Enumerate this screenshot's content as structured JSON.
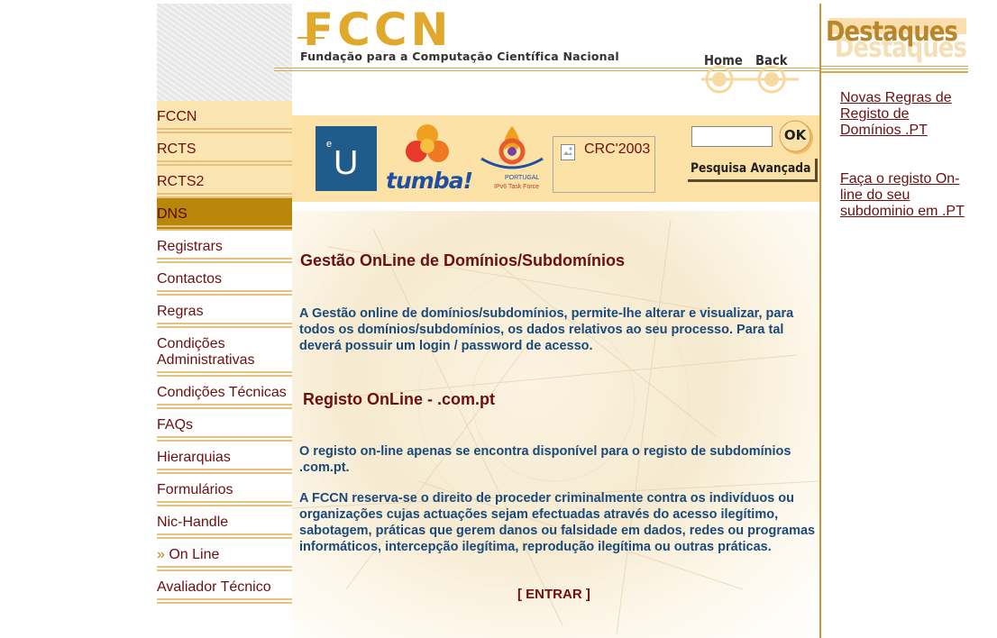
{
  "header": {
    "logo_text": "FCCN",
    "logo_subtitle": "Fundação para a Computação Científica Nacional",
    "home_label": "Home",
    "back_label": "Back"
  },
  "nav": {
    "items": [
      {
        "label": "FCCN"
      },
      {
        "label": "RCTS"
      },
      {
        "label": "RCTS2"
      },
      {
        "label": "DNS"
      },
      {
        "label": "Registrars"
      },
      {
        "label": "Contactos"
      },
      {
        "label": "Regras"
      },
      {
        "label": "Condições Administrativas"
      },
      {
        "label": "Condições Técnicas"
      },
      {
        "label": "FAQs"
      },
      {
        "label": "Hierarquias"
      },
      {
        "label": "Formulários"
      },
      {
        "label": "Nic-Handle"
      },
      {
        "label": "On Line",
        "marker": "»"
      },
      {
        "label": "Avaliador Técnico"
      }
    ]
  },
  "toolbar": {
    "eu_logo": {
      "super": "e",
      "letter": "U"
    },
    "tumba_label": "tumba!",
    "ipv6_caption1": "PORTUGAL",
    "ipv6_caption2": "IPv6 Task Force",
    "crc_label": "CRC'2003",
    "search_value": "",
    "ok_label": "OK",
    "advanced_search_label": "Pesquisa Avançada"
  },
  "main": {
    "section1_title": "Gestão OnLine de Domínios/Subdomínios",
    "section1_text": "A Gestão online de domínios/subdomínios, permite-lhe alterar e visualizar, para todos os domínios/subdomínios, os dados relativos ao seu processo. Para tal deverá possuir um login / password de acesso.",
    "section2_title": "Registo OnLine - .com.pt",
    "section2_text": "O registo on-line apenas se encontra disponível para o registo de subdomínios .com.pt.",
    "section2_text2": "A FCCN reserva-se o direito de proceder criminalmente contra os indivíduos ou organizações cujas actuações sejam efectuadas através do acesso ilegítimo, sabotagem, práticas que gerem danos ou falsidade em dados, redes ou programas informáticos, intercepção ilegítima, reprodução ilegítima ou outras práticas.",
    "enter_label": "[ ENTRAR ]"
  },
  "sidebar_right": {
    "heading": "Destaques",
    "links": [
      "Novas Regras de Registo de Domínios .PT",
      "Faça o registo On-line do seu subdominio em .PT"
    ]
  },
  "colors": {
    "nav_text": "#6b0f0f",
    "body_text": "#1a4a7a",
    "accent_gold": "#b8860b",
    "band": "#fde2a8"
  }
}
